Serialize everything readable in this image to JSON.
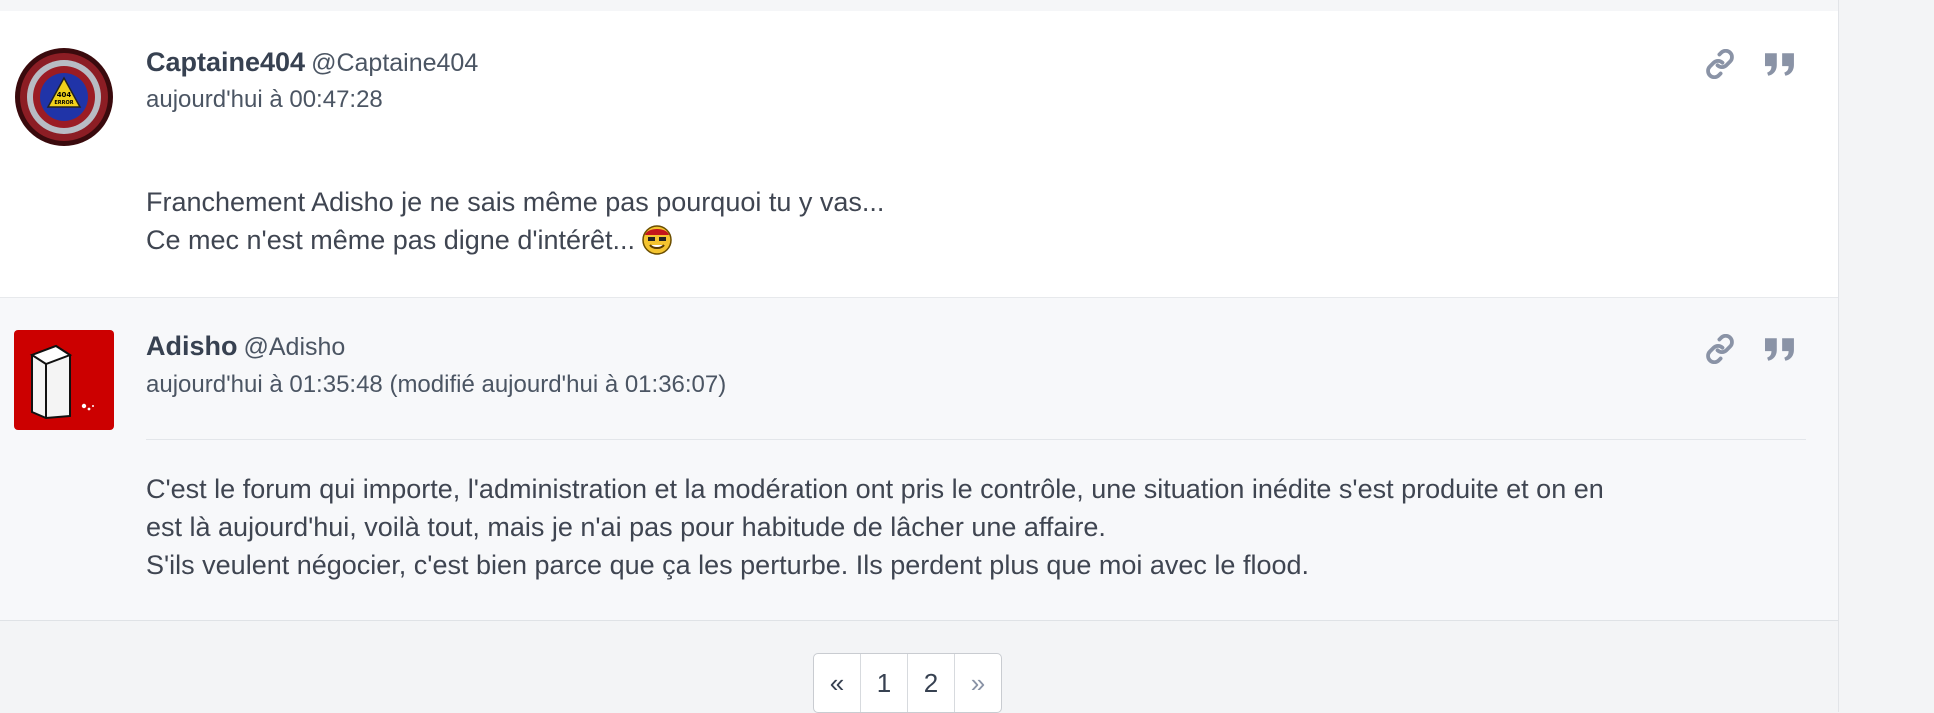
{
  "posts": [
    {
      "author": "Captaine404",
      "handle": "@Captaine404",
      "timestamp": "aujourd'hui à 00:47:28",
      "avatar_text": "404 ERROR",
      "lines": [
        "Franchement Adisho je ne sais même pas pourquoi tu y vas...",
        "Ce mec n'est même pas digne d'intérêt..."
      ],
      "emoji": "smiley-emoji"
    },
    {
      "author": "Adisho",
      "handle": "@Adisho",
      "timestamp": "aujourd'hui à 01:35:48 (modifié aujourd'hui à 01:36:07)",
      "lines": [
        "C'est le forum qui importe, l'administration et la modération ont pris le contrôle, une situation inédite s'est produite et on en",
        "est là aujourd'hui, voilà tout, mais je n'ai pas pour habitude de lâcher une affaire.",
        "S'ils veulent négocier, c'est bien parce que ça les perturbe. Ils perdent plus que moi avec le flood."
      ]
    }
  ],
  "pagination": {
    "prev": "«",
    "pages": [
      "1",
      "2"
    ],
    "next": "»"
  },
  "icons": {
    "link": "link-icon",
    "quote": "quote-icon"
  },
  "colors": {
    "icon": "#8a93a6",
    "avatar_red": "#cc0000"
  }
}
